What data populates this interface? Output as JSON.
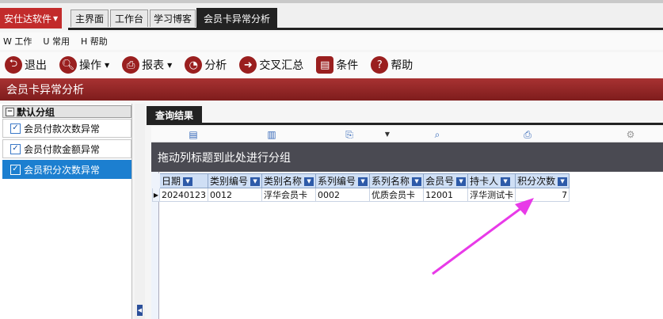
{
  "app": {
    "brand": "安仕达软件",
    "tabs": [
      {
        "label": "主界面"
      },
      {
        "label": "工作台"
      },
      {
        "label": "学习博客"
      },
      {
        "label": "会员卡异常分析"
      }
    ]
  },
  "menu": [
    {
      "key": "W",
      "label": "工作"
    },
    {
      "key": "U",
      "label": "常用"
    },
    {
      "key": "H",
      "label": "帮助"
    }
  ],
  "toolbar": {
    "exit": "退出",
    "operate": "操作",
    "report": "报表",
    "analyze": "分析",
    "cross": "交叉汇总",
    "condition": "条件",
    "help": "帮助"
  },
  "section_title": "会员卡异常分析",
  "left_panel": {
    "group_label": "默认分组",
    "items": [
      {
        "label": "会员付款次数异常",
        "checked": true
      },
      {
        "label": "会员付款金额异常",
        "checked": true
      },
      {
        "label": "会员积分次数异常",
        "checked": true
      }
    ]
  },
  "results": {
    "tab_label": "查询结果",
    "group_hint": "拖动列标题到此处进行分组",
    "columns": [
      "日期",
      "类别编号",
      "类别名称",
      "系列编号",
      "系列名称",
      "会员号",
      "持卡人",
      "积分次数"
    ],
    "rows": [
      [
        "20240123",
        "0012",
        "浮华会员卡",
        "0002",
        "优质会员卡",
        "12001",
        "浮华测试卡",
        "7"
      ]
    ]
  },
  "colors": {
    "brand_red": "#c22b2b",
    "section_red": "#8f2424",
    "arrow_magenta": "#e83ae8",
    "selected_blue": "#1c7fd0"
  }
}
